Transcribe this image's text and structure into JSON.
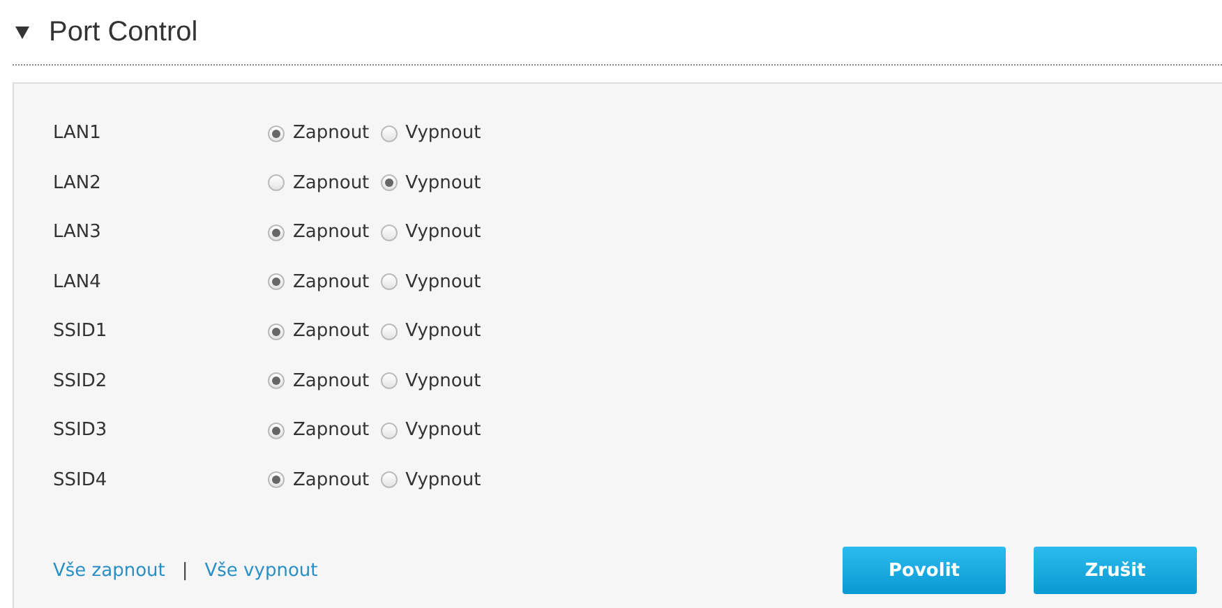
{
  "section": {
    "title": "Port Control",
    "expanded": true
  },
  "ports": [
    {
      "name": "LAN1",
      "options": [
        {
          "label": "Zapnout",
          "selected": true
        },
        {
          "label": "Vypnout",
          "selected": false
        }
      ]
    },
    {
      "name": "LAN2",
      "options": [
        {
          "label": "Zapnout",
          "selected": false
        },
        {
          "label": "Vypnout",
          "selected": true
        }
      ]
    },
    {
      "name": "LAN3",
      "options": [
        {
          "label": "Zapnout",
          "selected": true
        },
        {
          "label": "Vypnout",
          "selected": false
        }
      ]
    },
    {
      "name": "LAN4",
      "options": [
        {
          "label": "Zapnout",
          "selected": true
        },
        {
          "label": "Vypnout",
          "selected": false
        }
      ]
    },
    {
      "name": "SSID1",
      "options": [
        {
          "label": "Zapnout",
          "selected": true
        },
        {
          "label": "Vypnout",
          "selected": false
        }
      ]
    },
    {
      "name": "SSID2",
      "options": [
        {
          "label": "Zapnout",
          "selected": true
        },
        {
          "label": "Vypnout",
          "selected": false
        }
      ]
    },
    {
      "name": "SSID3",
      "options": [
        {
          "label": "Zapnout",
          "selected": true
        },
        {
          "label": "Vypnout",
          "selected": false
        }
      ]
    },
    {
      "name": "SSID4",
      "options": [
        {
          "label": "Zapnout",
          "selected": true
        },
        {
          "label": "Vypnout",
          "selected": false
        }
      ]
    }
  ],
  "links": [
    "Vše zapnout",
    "Vše vypnout"
  ],
  "separator": "|",
  "buttons": [
    "Povolit",
    "Zrušit"
  ]
}
